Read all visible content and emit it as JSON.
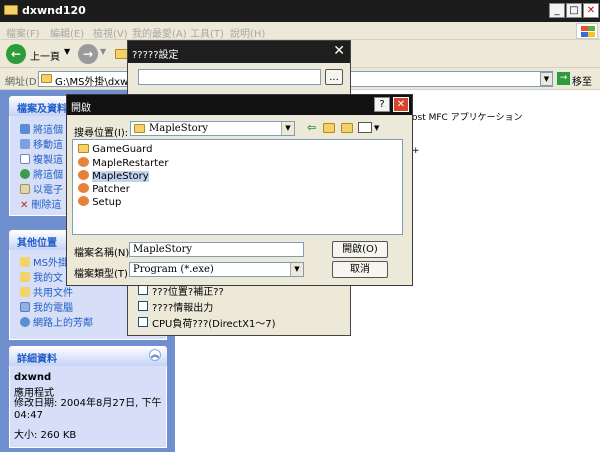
{
  "explorer": {
    "title": "dxwnd120",
    "menu": [
      "檔案(F)",
      "編輯(E)",
      "檢視(V)",
      "我的最愛(A)",
      "工具(T)",
      "說明(H)"
    ],
    "toolbar": {
      "back_label": "上一頁"
    },
    "address": {
      "label": "網址(D)",
      "path": "G:\\MS外掛\\dxwnd1",
      "go_label": "移至"
    },
    "content_snippet": "ost MFC アプリケーション",
    "tasks_panel": {
      "title": "檔案及資料",
      "items": [
        "將這個",
        "移動這",
        "複製這",
        "將這個",
        "以電子",
        "刪除這"
      ]
    },
    "places_panel": {
      "title": "其他位置",
      "items": [
        "MS外掛",
        "我的文",
        "共用文件",
        "我的電腦",
        "網路上的芳鄰"
      ]
    },
    "details_panel": {
      "title": "詳細資料",
      "name": "dxwnd",
      "type": "應用程式",
      "modified": "修改日期: 2004年8月27日, 下午 04:47",
      "size": "大小: 260 KB"
    }
  },
  "settings_dialog": {
    "title": "?????設定",
    "browse_label": "...",
    "options": [
      "???位置?補正??",
      "????情報出力",
      "CPU負荷???(DirectX1～7)"
    ]
  },
  "open_dialog": {
    "title": "開啟",
    "lookin_label": "搜尋位置(I):",
    "lookin_value": "MapleStory",
    "files": [
      "GameGuard",
      "MapleRestarter",
      "MapleStory",
      "Patcher",
      "Setup"
    ],
    "selected_index": 2,
    "filename_label": "檔案名稱(N):",
    "filename_value": "MapleStory",
    "filetype_label": "檔案類型(T):",
    "filetype_value": "Program (*.exe)",
    "open_button": "開啟(O)",
    "cancel_button": "取消"
  }
}
